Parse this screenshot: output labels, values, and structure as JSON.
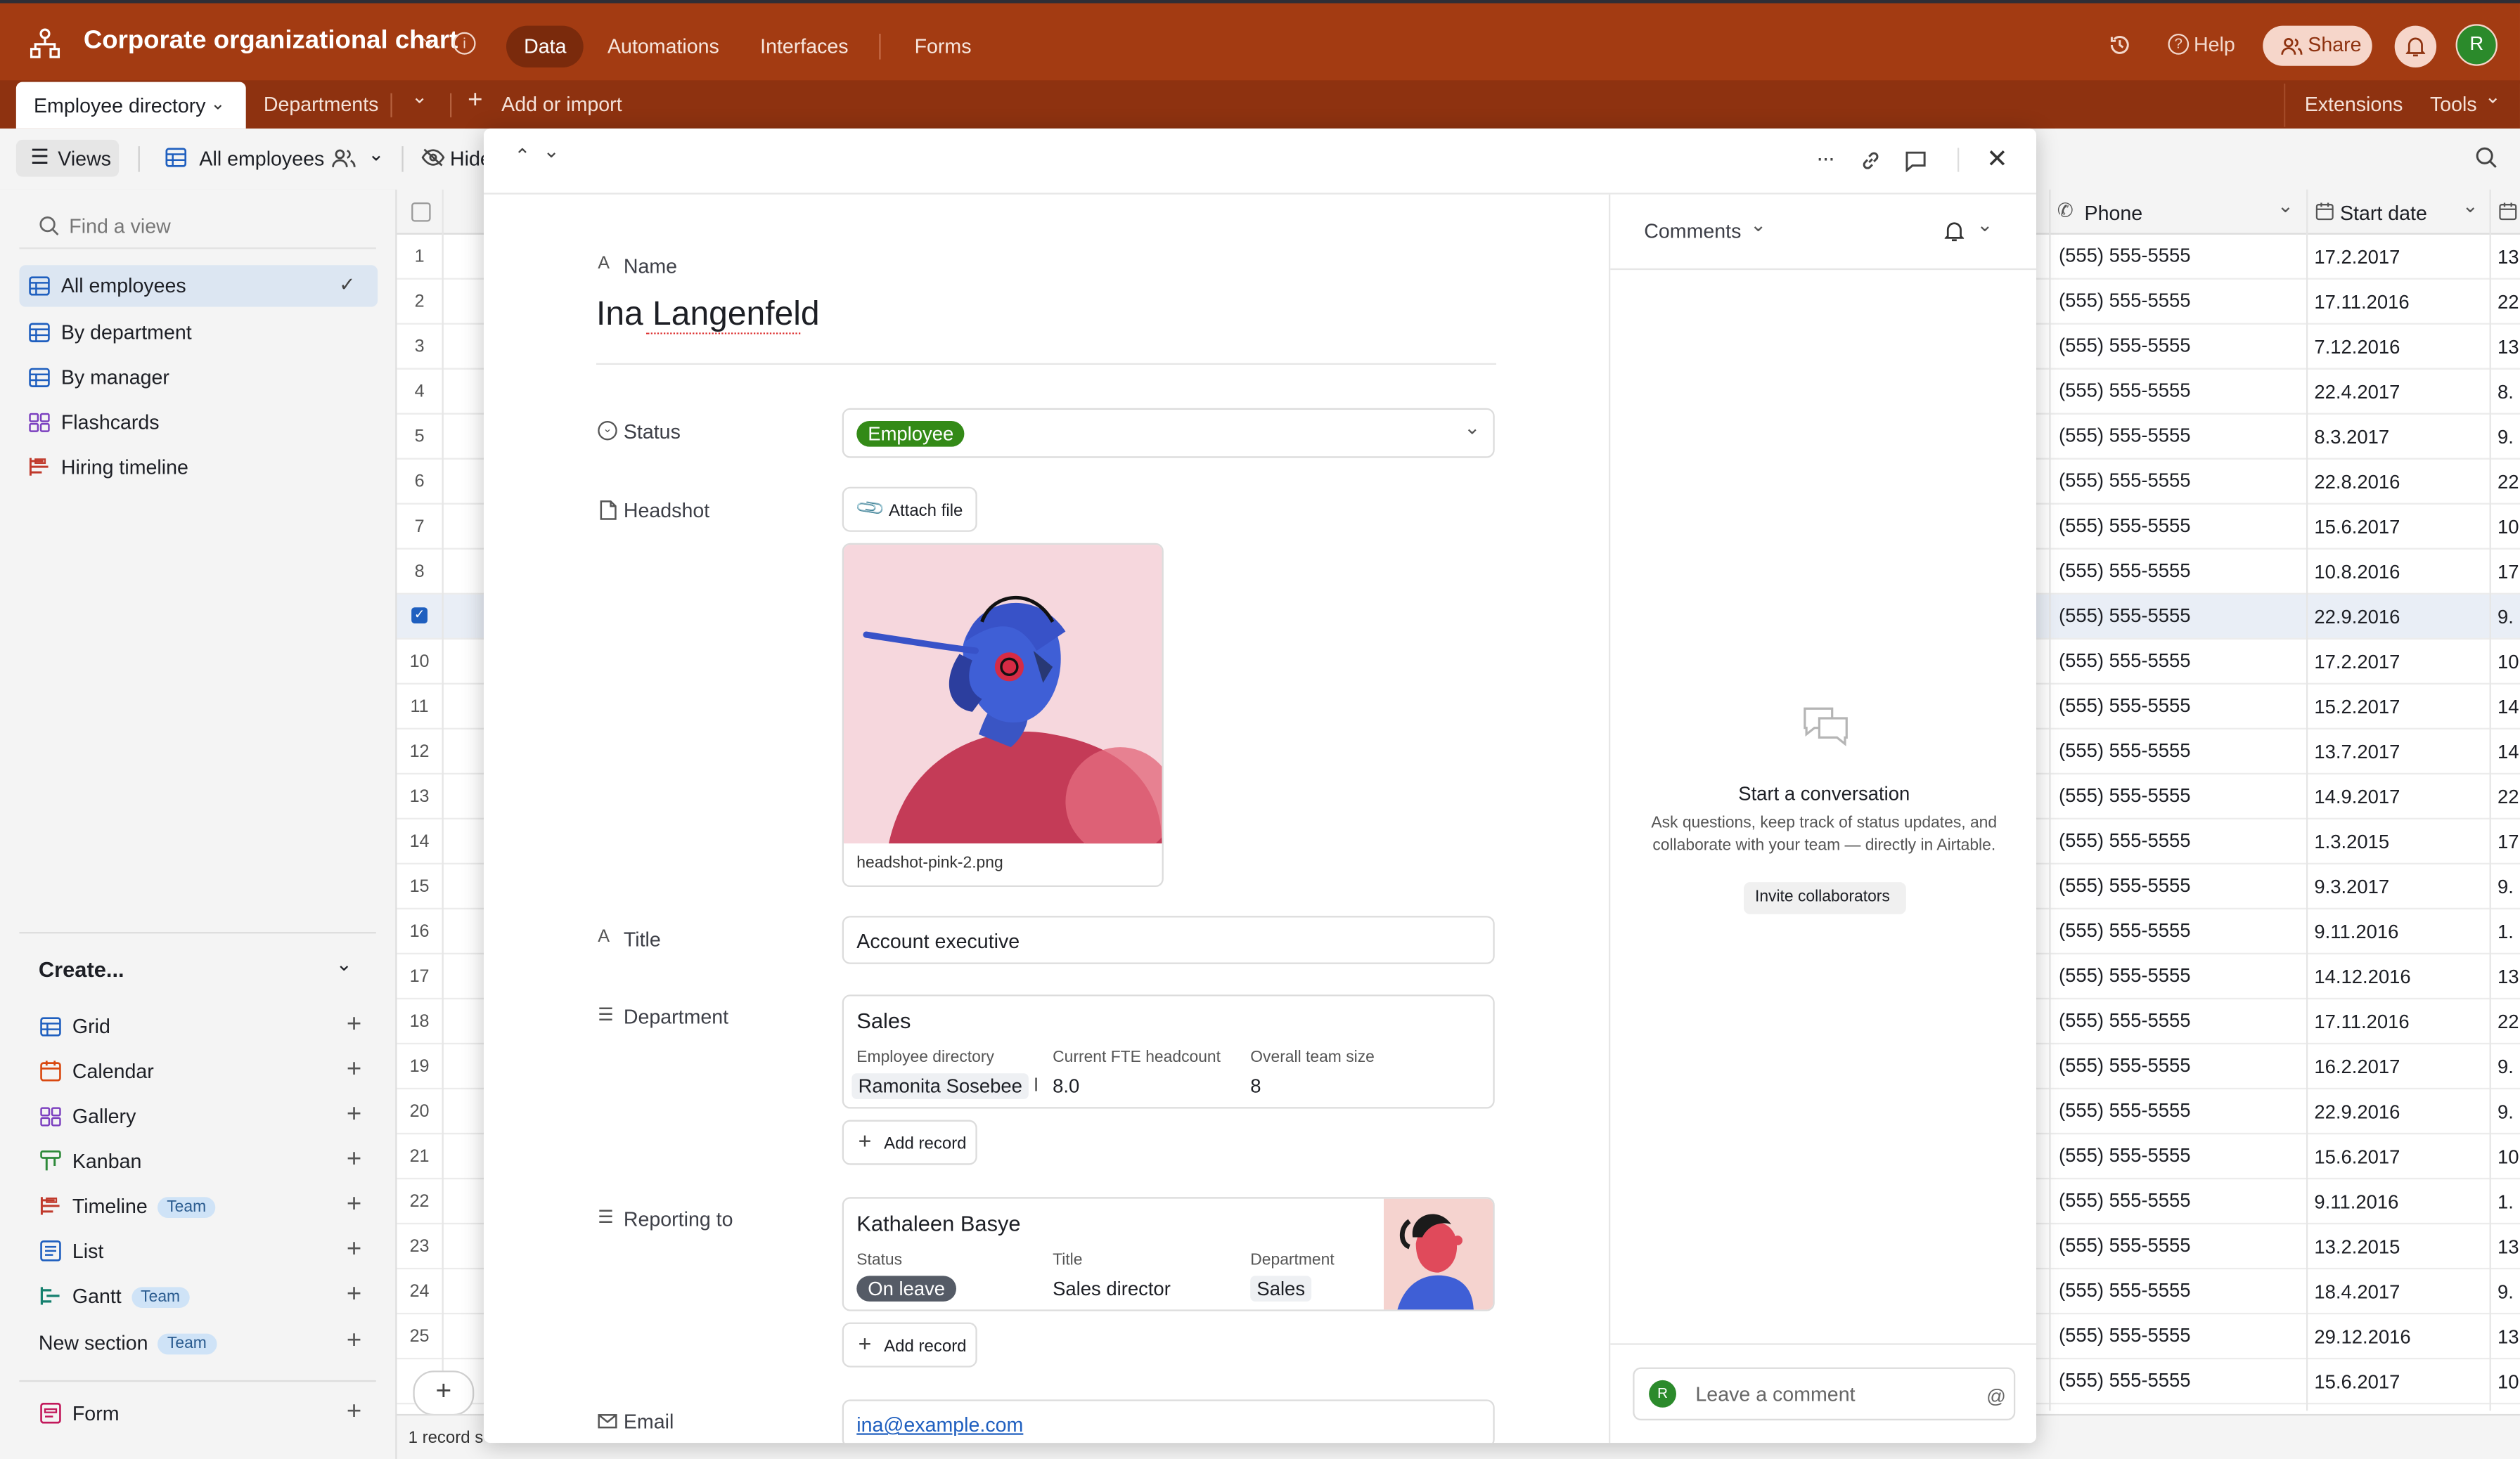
{
  "app": {
    "base_name": "Corporate organizational chart",
    "nav_tabs": [
      "Data",
      "Automations",
      "Interfaces",
      "Forms"
    ],
    "help_label": "Help",
    "share_label": "Share",
    "avatar_initial": "R",
    "brand_color": "#a33b12"
  },
  "tables": {
    "items": [
      "Employee directory",
      "Departments"
    ],
    "add_import": "Add or import",
    "extensions": "Extensions",
    "tools": "Tools"
  },
  "toolbar": {
    "views_label": "Views",
    "current_view": "All employees",
    "hide_label": "Hide"
  },
  "sidebar": {
    "find_placeholder": "Find a view",
    "views": [
      "All employees",
      "By department",
      "By manager",
      "Flashcards",
      "Hiring timeline"
    ],
    "create_label": "Create...",
    "create_items": [
      {
        "label": "Grid",
        "badge": ""
      },
      {
        "label": "Calendar",
        "badge": ""
      },
      {
        "label": "Gallery",
        "badge": ""
      },
      {
        "label": "Kanban",
        "badge": ""
      },
      {
        "label": "Timeline",
        "badge": "Team"
      },
      {
        "label": "List",
        "badge": ""
      },
      {
        "label": "Gantt",
        "badge": "Team"
      }
    ],
    "new_section": "New section",
    "new_section_badge": "Team",
    "form_label": "Form"
  },
  "grid": {
    "phone_header": "Phone",
    "start_header": "Start date",
    "rows": [
      {
        "n": "1",
        "phone": "(555) 555-5555",
        "date": "17.2.2017",
        "ext": "13"
      },
      {
        "n": "2",
        "phone": "(555) 555-5555",
        "date": "17.11.2016",
        "ext": "22"
      },
      {
        "n": "3",
        "phone": "(555) 555-5555",
        "date": "7.12.2016",
        "ext": "13"
      },
      {
        "n": "4",
        "phone": "(555) 555-5555",
        "date": "22.4.2017",
        "ext": "8."
      },
      {
        "n": "5",
        "phone": "(555) 555-5555",
        "date": "8.3.2017",
        "ext": "9."
      },
      {
        "n": "6",
        "phone": "(555) 555-5555",
        "date": "22.8.2016",
        "ext": "22"
      },
      {
        "n": "7",
        "phone": "(555) 555-5555",
        "date": "15.6.2017",
        "ext": "10"
      },
      {
        "n": "8",
        "phone": "(555) 555-5555",
        "date": "10.8.2016",
        "ext": "17"
      },
      {
        "n": "",
        "phone": "(555) 555-5555",
        "date": "22.9.2016",
        "ext": "9."
      },
      {
        "n": "10",
        "phone": "(555) 555-5555",
        "date": "17.2.2017",
        "ext": "10"
      },
      {
        "n": "11",
        "phone": "(555) 555-5555",
        "date": "15.2.2017",
        "ext": "14"
      },
      {
        "n": "12",
        "phone": "(555) 555-5555",
        "date": "13.7.2017",
        "ext": "14"
      },
      {
        "n": "13",
        "phone": "(555) 555-5555",
        "date": "14.9.2017",
        "ext": "22"
      },
      {
        "n": "14",
        "phone": "(555) 555-5555",
        "date": "1.3.2015",
        "ext": "17"
      },
      {
        "n": "15",
        "phone": "(555) 555-5555",
        "date": "9.3.2017",
        "ext": "9."
      },
      {
        "n": "16",
        "phone": "(555) 555-5555",
        "date": "9.11.2016",
        "ext": "1."
      },
      {
        "n": "17",
        "phone": "(555) 555-5555",
        "date": "14.12.2016",
        "ext": "13"
      },
      {
        "n": "18",
        "phone": "(555) 555-5555",
        "date": "17.11.2016",
        "ext": "22"
      },
      {
        "n": "19",
        "phone": "(555) 555-5555",
        "date": "16.2.2017",
        "ext": "9."
      },
      {
        "n": "20",
        "phone": "(555) 555-5555",
        "date": "22.9.2016",
        "ext": "9."
      },
      {
        "n": "21",
        "phone": "(555) 555-5555",
        "date": "15.6.2017",
        "ext": "10"
      },
      {
        "n": "22",
        "phone": "(555) 555-5555",
        "date": "9.11.2016",
        "ext": "1."
      },
      {
        "n": "23",
        "phone": "(555) 555-5555",
        "date": "13.2.2015",
        "ext": "13"
      },
      {
        "n": "24",
        "phone": "(555) 555-5555",
        "date": "18.4.2017",
        "ext": "9."
      },
      {
        "n": "25",
        "phone": "(555) 555-5555",
        "date": "29.12.2016",
        "ext": "13"
      },
      {
        "n": "",
        "phone": "(555) 555-5555",
        "date": "15.6.2017",
        "ext": "10"
      }
    ],
    "footer_count": "1 record s"
  },
  "record": {
    "name_label": "Name",
    "name_value": "Ina Langenfeld",
    "status_label": "Status",
    "status_value": "Employee",
    "status_color": "#338a17",
    "headshot_label": "Headshot",
    "attach_label": "Attach file",
    "headshot_filename": "headshot-pink-2.png",
    "title_label": "Title",
    "title_value": "Account executive",
    "department_label": "Department",
    "department": {
      "name": "Sales",
      "col1_label": "Employee directory",
      "col1_value": "Ramonita Sosebee",
      "col1_more": "I",
      "col2_label": "Current FTE headcount",
      "col2_value": "8.0",
      "col3_label": "Overall team size",
      "col3_value": "8"
    },
    "add_record_label": "Add record",
    "reporting_label": "Reporting to",
    "reporting": {
      "name": "Kathaleen Basye",
      "status_label": "Status",
      "status_value": "On leave",
      "title_label": "Title",
      "title_value": "Sales director",
      "dept_label": "Department",
      "dept_value": "Sales"
    },
    "email_label": "Email",
    "email_value": "ina@example.com"
  },
  "comments": {
    "header": "Comments",
    "empty_title": "Start a conversation",
    "empty_body_1": "Ask questions, keep track of status updates, and",
    "empty_body_2": "collaborate with your team — directly in Airtable.",
    "invite_label": "Invite collaborators",
    "placeholder": "Leave a comment"
  }
}
